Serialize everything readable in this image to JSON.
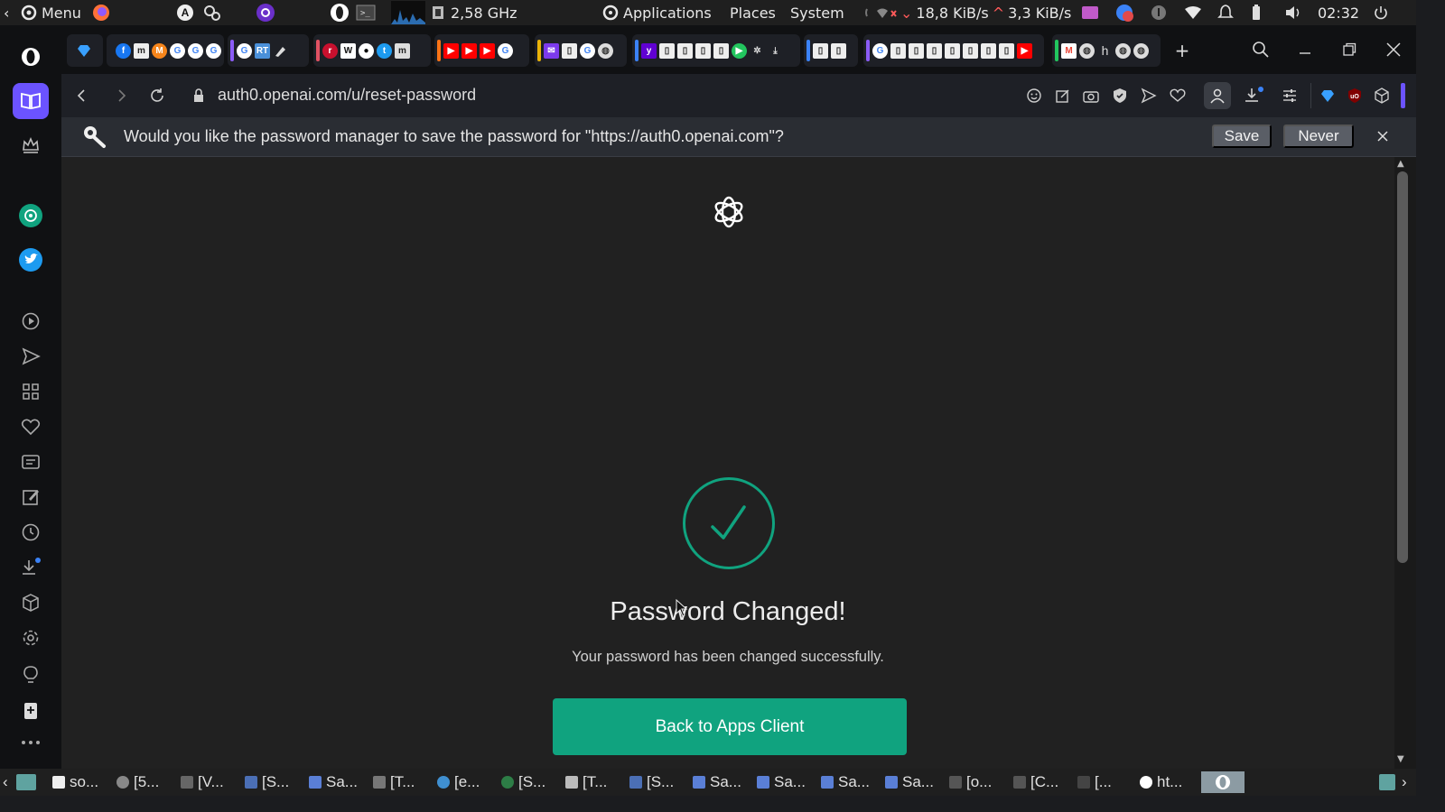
{
  "os_panel": {
    "menu_label": "Menu",
    "cpu_freq": "2,58 GHz",
    "applications_label": "Applications",
    "places_label": "Places",
    "system_label": "System",
    "net_down": "18,8 KiB/s",
    "net_up": "3,3 KiB/s",
    "clock": "02:32"
  },
  "browser": {
    "url": "auth0.openai.com/u/reset-password",
    "tab_group_letter": "h"
  },
  "password_prompt": {
    "message": "Would you like the password manager to save the password for \"https://auth0.openai.com\"?",
    "save_label": "Save",
    "never_label": "Never"
  },
  "page": {
    "headline": "Password Changed!",
    "subline": "Your password has been changed successfully.",
    "button_label": "Back to Apps Client",
    "accent_color": "#10a37f"
  },
  "taskbar": {
    "items": [
      {
        "label": "so..."
      },
      {
        "label": "[5..."
      },
      {
        "label": "[V..."
      },
      {
        "label": "[S..."
      },
      {
        "label": "Sa..."
      },
      {
        "label": "[T..."
      },
      {
        "label": "[e..."
      },
      {
        "label": "[S..."
      },
      {
        "label": "[T..."
      },
      {
        "label": "[S..."
      },
      {
        "label": "Sa..."
      },
      {
        "label": "Sa..."
      },
      {
        "label": "Sa..."
      },
      {
        "label": "Sa..."
      },
      {
        "label": "[o..."
      },
      {
        "label": "[C..."
      },
      {
        "label": "[..."
      },
      {
        "label": "ht..."
      }
    ]
  }
}
